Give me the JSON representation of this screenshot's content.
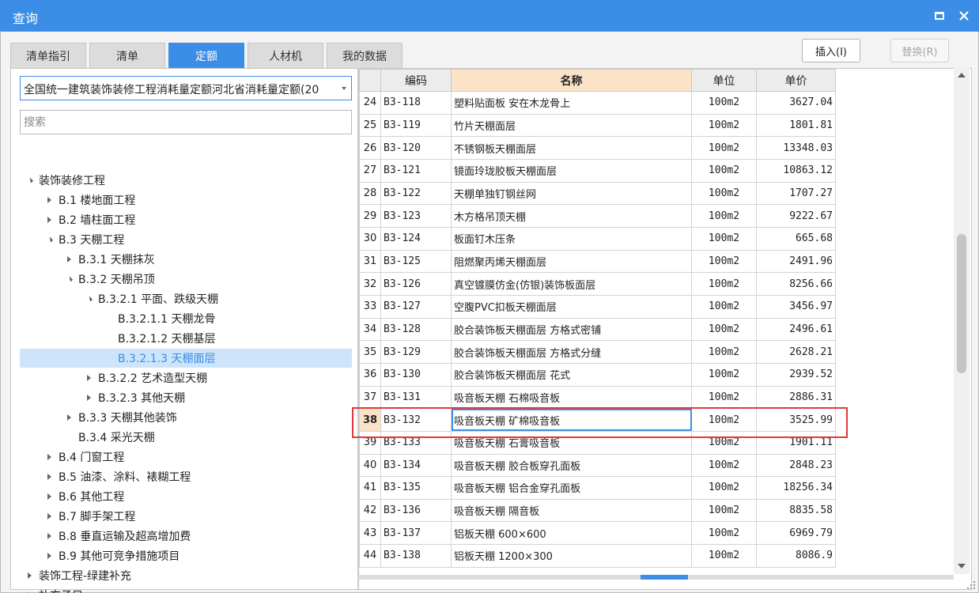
{
  "window": {
    "title": "查询"
  },
  "tabs": [
    {
      "label": "清单指引",
      "active": false
    },
    {
      "label": "清单",
      "active": false
    },
    {
      "label": "定额",
      "active": true
    },
    {
      "label": "人材机",
      "active": false
    },
    {
      "label": "我的数据",
      "active": false
    }
  ],
  "buttons": {
    "insert": "插入(I)",
    "replace": "替换(R)"
  },
  "left": {
    "dropdown_value": "全国统一建筑装饰装修工程消耗量定额河北省消耗量定额(20",
    "search_placeholder": "搜索",
    "tree": [
      {
        "label": "装饰装修工程",
        "level": 0,
        "state": "expanded"
      },
      {
        "label": "B.1 楼地面工程",
        "level": 1,
        "state": "collapsed"
      },
      {
        "label": "B.2 墙柱面工程",
        "level": 1,
        "state": "collapsed"
      },
      {
        "label": "B.3 天棚工程",
        "level": 1,
        "state": "expanded"
      },
      {
        "label": "B.3.1 天棚抹灰",
        "level": 2,
        "state": "collapsed"
      },
      {
        "label": "B.3.2 天棚吊顶",
        "level": 2,
        "state": "expanded"
      },
      {
        "label": "B.3.2.1 平面、跌级天棚",
        "level": 3,
        "state": "expanded"
      },
      {
        "label": "B.3.2.1.1 天棚龙骨",
        "level": 4,
        "state": "leaf"
      },
      {
        "label": "B.3.2.1.2 天棚基层",
        "level": 4,
        "state": "leaf"
      },
      {
        "label": "B.3.2.1.3 天棚面层",
        "level": 4,
        "state": "leaf",
        "selected": true
      },
      {
        "label": "B.3.2.2 艺术造型天棚",
        "level": 3,
        "state": "collapsed"
      },
      {
        "label": "B.3.2.3 其他天棚",
        "level": 3,
        "state": "collapsed"
      },
      {
        "label": "B.3.3 天棚其他装饰",
        "level": 2,
        "state": "collapsed"
      },
      {
        "label": "B.3.4 采光天棚",
        "level": 2,
        "state": "leaf"
      },
      {
        "label": "B.4 门窗工程",
        "level": 1,
        "state": "collapsed"
      },
      {
        "label": "B.5 油漆、涂料、裱糊工程",
        "level": 1,
        "state": "collapsed"
      },
      {
        "label": "B.6 其他工程",
        "level": 1,
        "state": "collapsed"
      },
      {
        "label": "B.7 脚手架工程",
        "level": 1,
        "state": "collapsed"
      },
      {
        "label": "B.8 垂直运输及超高增加费",
        "level": 1,
        "state": "collapsed"
      },
      {
        "label": "B.9 其他可竞争措施项目",
        "level": 1,
        "state": "collapsed"
      },
      {
        "label": "装饰工程-绿建补充",
        "level": 0,
        "state": "collapsed"
      },
      {
        "label": "补充子目",
        "level": 0,
        "state": "collapsed"
      }
    ]
  },
  "grid": {
    "columns": {
      "code": "编码",
      "name": "名称",
      "unit": "单位",
      "price": "单价"
    },
    "rows": [
      {
        "n": "24",
        "code": "B3-118",
        "name": "塑料贴面板 安在木龙骨上",
        "unit": "100m2",
        "price": "3627.04"
      },
      {
        "n": "25",
        "code": "B3-119",
        "name": "竹片天棚面层",
        "unit": "100m2",
        "price": "1801.81"
      },
      {
        "n": "26",
        "code": "B3-120",
        "name": "不锈钢板天棚面层",
        "unit": "100m2",
        "price": "13348.03"
      },
      {
        "n": "27",
        "code": "B3-121",
        "name": "镜面玲珑胶板天棚面层",
        "unit": "100m2",
        "price": "10863.12"
      },
      {
        "n": "28",
        "code": "B3-122",
        "name": "天棚单独钉钢丝网",
        "unit": "100m2",
        "price": "1707.27"
      },
      {
        "n": "29",
        "code": "B3-123",
        "name": "木方格吊顶天棚",
        "unit": "100m2",
        "price": "9222.67"
      },
      {
        "n": "30",
        "code": "B3-124",
        "name": "板面钉木压条",
        "unit": "100m2",
        "price": "665.68"
      },
      {
        "n": "31",
        "code": "B3-125",
        "name": "阻燃聚丙烯天棚面层",
        "unit": "100m2",
        "price": "2491.96"
      },
      {
        "n": "32",
        "code": "B3-126",
        "name": "真空镀膜仿金(仿银)装饰板面层",
        "unit": "100m2",
        "price": "8256.66"
      },
      {
        "n": "33",
        "code": "B3-127",
        "name": "空腹PVC扣板天棚面层",
        "unit": "100m2",
        "price": "3456.97"
      },
      {
        "n": "34",
        "code": "B3-128",
        "name": "胶合装饰板天棚面层 方格式密铺",
        "unit": "100m2",
        "price": "2496.61"
      },
      {
        "n": "35",
        "code": "B3-129",
        "name": "胶合装饰板天棚面层 方格式分缝",
        "unit": "100m2",
        "price": "2628.21"
      },
      {
        "n": "36",
        "code": "B3-130",
        "name": "胶合装饰板天棚面层 花式",
        "unit": "100m2",
        "price": "2939.52"
      },
      {
        "n": "37",
        "code": "B3-131",
        "name": "吸音板天棚 石棉吸音板",
        "unit": "100m2",
        "price": "2886.31"
      },
      {
        "n": "38",
        "code": "B3-132",
        "name": "吸音板天棚 矿棉吸音板",
        "unit": "100m2",
        "price": "3525.99",
        "selected": true
      },
      {
        "n": "39",
        "code": "B3-133",
        "name": "吸音板天棚 石膏吸音板",
        "unit": "100m2",
        "price": "1901.11"
      },
      {
        "n": "40",
        "code": "B3-134",
        "name": "吸音板天棚 胶合板穿孔面板",
        "unit": "100m2",
        "price": "2848.23"
      },
      {
        "n": "41",
        "code": "B3-135",
        "name": "吸音板天棚 铝合金穿孔面板",
        "unit": "100m2",
        "price": "18256.34"
      },
      {
        "n": "42",
        "code": "B3-136",
        "name": "吸音板天棚 隔音板",
        "unit": "100m2",
        "price": "8835.58"
      },
      {
        "n": "43",
        "code": "B3-137",
        "name": "铝板天棚 600×600",
        "unit": "100m2",
        "price": "6969.79"
      },
      {
        "n": "44",
        "code": "B3-138",
        "name": "铝板天棚 1200×300",
        "unit": "100m2",
        "price": "8086.9"
      }
    ]
  }
}
